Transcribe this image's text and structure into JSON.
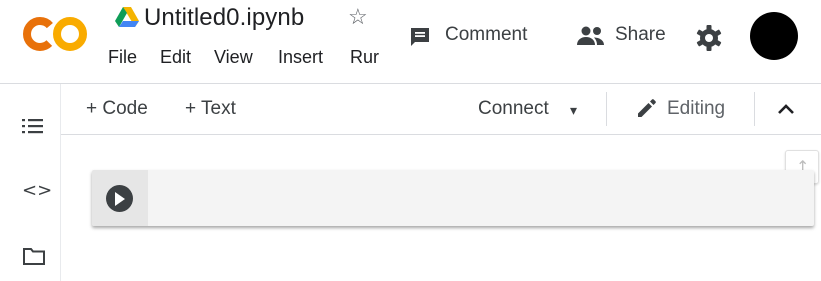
{
  "header": {
    "logo_text": "CO",
    "title": "Untitled0.ipynb",
    "star_glyph": "☆",
    "menu": [
      "File",
      "Edit",
      "View",
      "Insert",
      "Rur"
    ],
    "comment_label": "Comment",
    "share_label": "Share"
  },
  "toolbar": {
    "add_code_label": "+ Code",
    "add_text_label": "+ Text",
    "connect_label": "Connect",
    "connect_caret": "▾",
    "editing_label": "Editing"
  },
  "sidebar": {
    "code_glyph": "<>"
  },
  "content": {
    "scroll_up_glyph": "↑"
  },
  "icons": {
    "logo": "colab-logo",
    "drive": "drive-icon",
    "star": "star-icon",
    "comment": "comment-icon",
    "share": "people-icon",
    "settings": "gear-icon",
    "toc": "table-of-contents-icon",
    "code": "code-snippets-icon",
    "files": "folder-icon",
    "edit": "pencil-icon",
    "collapse": "chevron-up-icon",
    "run": "play-icon"
  },
  "colors": {
    "logo_orange": "#F9AB00",
    "logo_dark_orange": "#E8710A",
    "drive_blue": "#4285F4",
    "drive_green": "#0F9D58",
    "drive_yellow": "#F4B400",
    "icon_dark": "#3c4043",
    "avatar": "#000000"
  }
}
